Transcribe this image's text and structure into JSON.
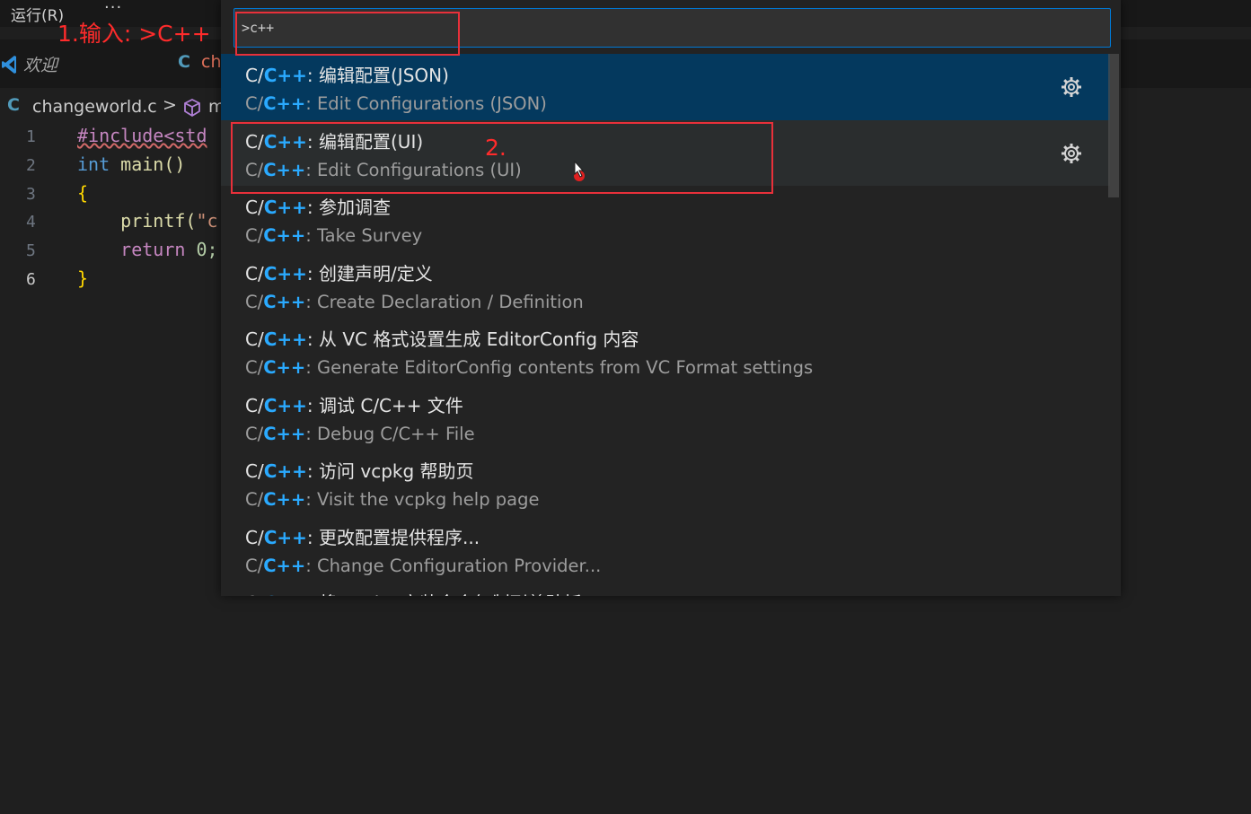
{
  "menubar": {
    "run_menu": "运行(R)",
    "more": "···"
  },
  "tabs": [
    {
      "icon": "vscode-icon",
      "label": "欢迎"
    },
    {
      "icon": "c-file-icon",
      "icon_text": "C",
      "label": "ch"
    }
  ],
  "breadcrumb": {
    "icon_text": "C",
    "file": "changeworld.c",
    "separator": ">",
    "symbol_icon": "cube-icon",
    "symbol": "m"
  },
  "editor": {
    "lines": [
      {
        "n": "1",
        "text": "#include<std"
      },
      {
        "n": "2",
        "kw": "int",
        "fn": " main()"
      },
      {
        "n": "3",
        "text": "{"
      },
      {
        "n": "4",
        "fn": "    printf(",
        "str": "\"c"
      },
      {
        "n": "5",
        "kw": "    return",
        "num": " 0;"
      },
      {
        "n": "6",
        "text": "}"
      }
    ]
  },
  "annotations": {
    "step1": "1.输入: >C++",
    "step2": "2."
  },
  "palette": {
    "input_value": ">c++",
    "items": [
      {
        "prefix": "C/",
        "hl": "C++",
        "rest1": ": 编辑配置(JSON)",
        "rest2": ": Edit Configurations (JSON)",
        "gear": true,
        "state": "selected"
      },
      {
        "prefix": "C/",
        "hl": "C++",
        "rest1": ": 编辑配置(UI)",
        "rest2": ": Edit Configurations (UI)",
        "gear": true,
        "state": "hover"
      },
      {
        "prefix": "C/",
        "hl": "C++",
        "rest1": ": 参加调查",
        "rest2": ": Take Survey"
      },
      {
        "prefix": "C/",
        "hl": "C++",
        "rest1": ": 创建声明/定义",
        "rest2": ": Create Declaration / Definition"
      },
      {
        "prefix": "C/",
        "hl": "C++",
        "rest1": ": 从 VC 格式设置生成 EditorConfig 内容",
        "rest2": ": Generate EditorConfig contents from VC Format settings"
      },
      {
        "prefix": "C/",
        "hl": "C++",
        "rest1": ": 调试 C/C++ 文件",
        "rest2": ": Debug C/C++ File"
      },
      {
        "prefix": "C/",
        "hl": "C++",
        "rest1": ": 访问 vcpkg 帮助页",
        "rest2": ": Visit the vcpkg help page"
      },
      {
        "prefix": "C/",
        "hl": "C++",
        "rest1": ": 更改配置提供程序...",
        "rest2": ": Change Configuration Provider..."
      },
      {
        "prefix": "C/",
        "hl": "C++",
        "rest1": ": 将 vcpkg 安装命令复制到剪贴板",
        "rest2": ""
      }
    ]
  },
  "colors": {
    "accent": "#0078d4",
    "highlight": "#2aaaff",
    "annotation": "#ff2b2b",
    "selected_bg": "#04395e"
  }
}
